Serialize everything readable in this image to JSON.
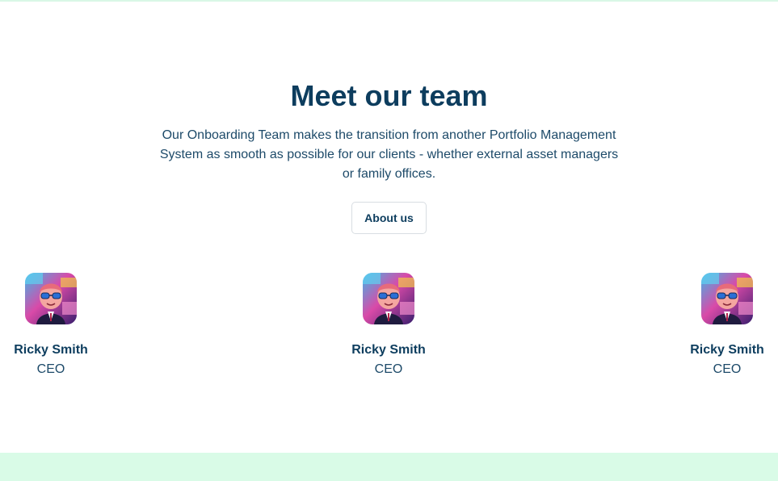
{
  "section": {
    "title": "Meet our team",
    "description": "Our Onboarding Team makes the transition from another Portfolio Management System as smooth as possible for our clients - whether external asset managers or family offices.",
    "about_button_label": "About us"
  },
  "team": [
    {
      "name": "Ricky Smith",
      "role": "CEO",
      "avatar": "cartoon-portrait-avatar"
    },
    {
      "name": "Ricky Smith",
      "role": "CEO",
      "avatar": "cartoon-portrait-avatar"
    },
    {
      "name": "Ricky Smith",
      "role": "CEO",
      "avatar": "cartoon-portrait-avatar"
    }
  ],
  "colors": {
    "heading": "#0d3d5e",
    "text": "#1d4a69",
    "band": "#d9fbe7",
    "button_border": "#d8dde2"
  }
}
